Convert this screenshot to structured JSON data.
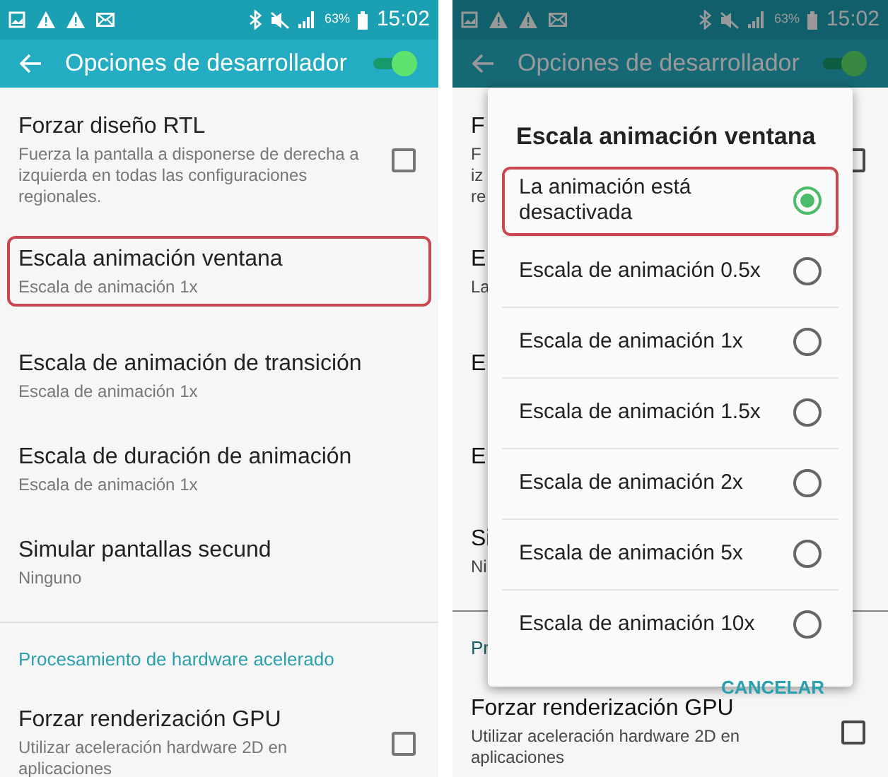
{
  "screens": [
    {
      "status_bar": {
        "battery": "63%",
        "time": "15:02"
      },
      "app_bar": {
        "title": "Opciones de desarrollador",
        "switch_on": true
      },
      "dimmed": false,
      "items": [
        {
          "kind": "checkbox",
          "title": "Forzar diseño RTL",
          "subtitle": "Fuerza la pantalla a disponerse de derecha a izquierda en todas las configuraciones regionales.",
          "checked": false,
          "highlighted": false
        },
        {
          "kind": "plain",
          "title": "Escala animación ventana",
          "subtitle": "Escala de animación 1x",
          "highlighted": true
        },
        {
          "kind": "plain",
          "title": "Escala de animación de transición",
          "subtitle": "Escala de animación 1x",
          "highlighted": false
        },
        {
          "kind": "plain",
          "title": "Escala de duración de animación",
          "subtitle": "Escala de animación 1x",
          "highlighted": false
        },
        {
          "kind": "plain",
          "title": "Simular pantallas secund",
          "subtitle": "Ninguno",
          "highlighted": false
        },
        {
          "kind": "category",
          "title": "Procesamiento de hardware acelerado"
        },
        {
          "kind": "checkbox",
          "title": "Forzar renderización GPU",
          "subtitle": "Utilizar aceleración hardware 2D en aplicaciones",
          "checked": false,
          "highlighted": false
        }
      ]
    },
    {
      "status_bar": {
        "battery": "63%",
        "time": "15:02"
      },
      "app_bar": {
        "title": "Opciones de desarrollador",
        "switch_on": true
      },
      "dimmed": true,
      "items": [
        {
          "kind": "checkbox",
          "title": "F",
          "subtitle": "F\niz\nre",
          "checked": false,
          "highlighted": false
        },
        {
          "kind": "plain",
          "title": "E",
          "subtitle": "La",
          "highlighted": false
        },
        {
          "kind": "plain",
          "title": "E",
          "highlighted": false
        },
        {
          "kind": "plain",
          "title": "E",
          "highlighted": false
        },
        {
          "kind": "plain",
          "title": "Si",
          "subtitle": "Ni",
          "highlighted": false
        },
        {
          "kind": "category",
          "title": "Pr"
        },
        {
          "kind": "checkbox",
          "title": "Forzar renderización GPU",
          "subtitle": "Utilizar aceleración hardware 2D en aplicaciones",
          "checked": false,
          "highlighted": false
        }
      ],
      "dialog": {
        "title": "Escala animación ventana",
        "options": [
          {
            "label": "La animación está desactivada",
            "selected": true,
            "highlighted": true
          },
          {
            "label": "Escala de animación 0.5x",
            "selected": false,
            "highlighted": false
          },
          {
            "label": "Escala de animación 1x",
            "selected": false,
            "highlighted": false
          },
          {
            "label": "Escala de animación 1.5x",
            "selected": false,
            "highlighted": false
          },
          {
            "label": "Escala de animación 2x",
            "selected": false,
            "highlighted": false
          },
          {
            "label": "Escala de animación 5x",
            "selected": false,
            "highlighted": false
          },
          {
            "label": "Escala de animación 10x",
            "selected": false,
            "highlighted": false
          }
        ],
        "cancel_button": "CANCELAR"
      }
    }
  ]
}
